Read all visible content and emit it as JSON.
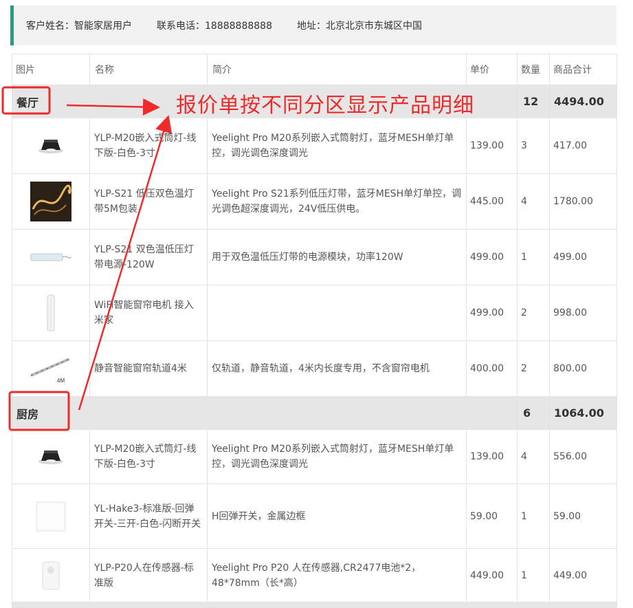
{
  "customer": {
    "name_label": "客户姓名：智能家居用户",
    "phone_label": "联系电话：18888888888",
    "address_label": "地址：北京北京市东城区中国"
  },
  "table": {
    "headers": [
      "图片",
      "名称",
      "简介",
      "单价",
      "数量",
      "商品合计"
    ],
    "zones": [
      {
        "name": "餐厅",
        "qty": "12",
        "total": "4494.00",
        "items": [
          {
            "image": "downlight-icon",
            "name": "YLP-M20嵌入式筒灯-线下版-白色-3寸",
            "desc": "Yeelight Pro M20系列嵌入式筒射灯，蓝牙MESH单灯单控，调光调色深度调光",
            "price": "139.00",
            "qty": "3",
            "total": "417.00"
          },
          {
            "image": "light-strip-icon",
            "name": "YLP-S21 低压双色温灯带5M包装",
            "desc": "Yeelight Pro S21系列低压灯带，蓝牙MESH单灯单控，调光调色超深度调光，24V低压供电。",
            "price": "445.00",
            "qty": "4",
            "total": "1780.00"
          },
          {
            "image": "power-module-icon",
            "name": "YLP-S21 双色温低压灯带电源-120W",
            "desc": "用于双色温低压灯带的电源模块，功率120W",
            "price": "499.00",
            "qty": "1",
            "total": "499.00"
          },
          {
            "image": "curtain-motor-icon",
            "name": "WiFi智能窗帘电机 接入米家",
            "desc": "",
            "price": "499.00",
            "qty": "2",
            "total": "998.00"
          },
          {
            "image": "curtain-track-icon",
            "name": "静音智能窗帘轨道4米",
            "desc": "仅轨道，静音轨道，4米内长度专用，不含窗帘电机",
            "price": "400.00",
            "qty": "2",
            "total": "800.00"
          }
        ]
      },
      {
        "name": "厨房",
        "qty": "6",
        "total": "1064.00",
        "items": [
          {
            "image": "downlight-icon",
            "name": "YLP-M20嵌入式筒灯-线下版-白色-3寸",
            "desc": "Yeelight Pro M20系列嵌入式筒射灯，蓝牙MESH单灯单控，调光调色深度调光",
            "price": "139.00",
            "qty": "4",
            "total": "556.00"
          },
          {
            "image": "switch-panel-icon",
            "name": "YL-Hake3-标准版-回弹开关-三开-白色-闪断开关",
            "desc": "H回弹开关，金属边框",
            "price": "59.00",
            "qty": "1",
            "total": "59.00"
          },
          {
            "image": "motion-sensor-icon",
            "name": "YLP-P20人在传感器-标准版",
            "desc": "Yeelight Pro P20 人在传感器,CR2477电池*2，48*78mm（长*高）",
            "price": "449.00",
            "qty": "1",
            "total": "449.00"
          }
        ]
      }
    ]
  },
  "track_label": "4M",
  "annotation": {
    "text": "报价单按不同分区显示产品明细",
    "color": "#ee2a2a"
  },
  "colors": {
    "accent": "#1aa37f",
    "zone_bg": "#e6e6e6",
    "annotation": "#ee2a2a"
  }
}
